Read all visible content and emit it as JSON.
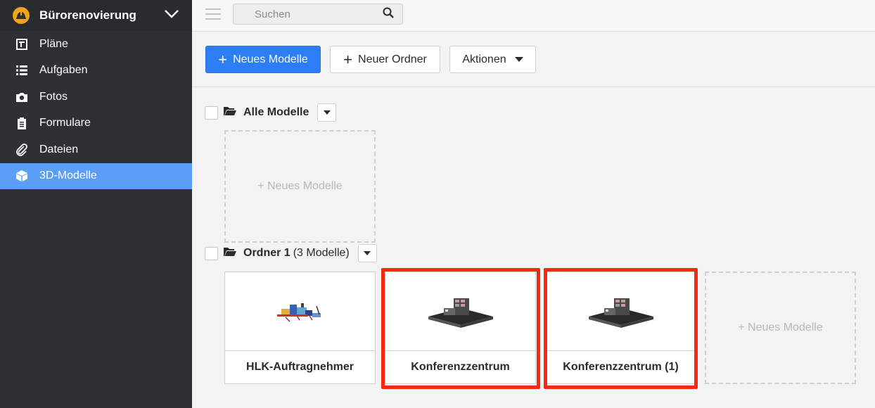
{
  "project": {
    "name": "Bürorenovierung",
    "logo_icon": "hard-hat-icon",
    "chevron_icon": "chevron-down-icon"
  },
  "sidebar": {
    "items": [
      {
        "label": "Pläne",
        "icon": "plans-icon",
        "active": false
      },
      {
        "label": "Aufgaben",
        "icon": "list-icon",
        "active": false
      },
      {
        "label": "Fotos",
        "icon": "camera-icon",
        "active": false
      },
      {
        "label": "Formulare",
        "icon": "clipboard-icon",
        "active": false
      },
      {
        "label": "Dateien",
        "icon": "paperclip-icon",
        "active": false
      },
      {
        "label": "3D-Modelle",
        "icon": "cube-icon",
        "active": true
      }
    ]
  },
  "topbar": {
    "search": {
      "placeholder": "Suchen"
    }
  },
  "toolbar": {
    "new_model": "Neues Modelle",
    "new_folder": "Neuer Ordner",
    "actions": "Aktionen"
  },
  "folders": [
    {
      "name": "Alle Modelle",
      "count": "",
      "placeholder": "+ Neues Modelle",
      "models": []
    },
    {
      "name": "Ordner 1",
      "count": "(3 Modelle)",
      "placeholder": "+ Neues Modelle",
      "models": [
        {
          "title": "HLK-Auftragnehmer",
          "highlighted": false
        },
        {
          "title": "Konferenzzentrum",
          "highlighted": true
        },
        {
          "title": "Konferenzzentrum (1)",
          "highlighted": true
        }
      ]
    }
  ],
  "colors": {
    "accent": "#2d7df6",
    "sidebar_active": "#5b9ef6",
    "highlight": "#f32a13",
    "sidebar_bg": "#2f3033"
  }
}
